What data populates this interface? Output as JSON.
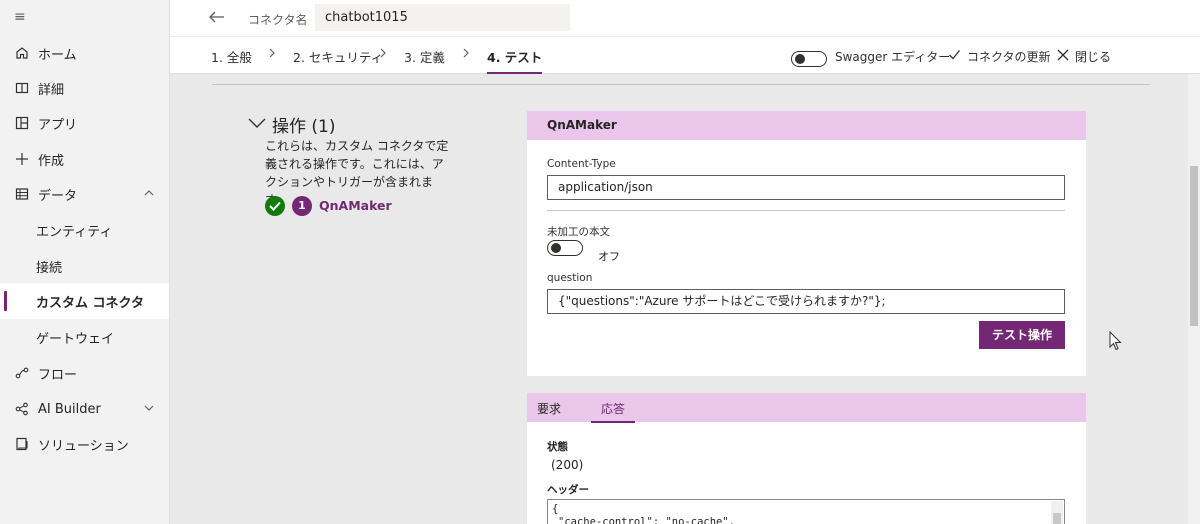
{
  "sidebar": {
    "items": [
      {
        "label": "ホーム",
        "icon": "home-icon"
      },
      {
        "label": "詳細",
        "icon": "book-icon"
      },
      {
        "label": "アプリ",
        "icon": "apps-icon"
      },
      {
        "label": "作成",
        "icon": "plus-icon"
      },
      {
        "label": "データ",
        "icon": "table-icon"
      },
      {
        "label": "エンティティ"
      },
      {
        "label": "接続"
      },
      {
        "label": "カスタム コネクタ"
      },
      {
        "label": "ゲートウェイ"
      },
      {
        "label": "フロー",
        "icon": "flow-icon"
      },
      {
        "label": "AI Builder",
        "icon": "ai-builder-icon"
      },
      {
        "label": "ソリューション",
        "icon": "solution-icon"
      }
    ],
    "active": "カスタム コネクタ"
  },
  "header": {
    "connector_label": "コネクタ名",
    "connector_name": "chatbot1015"
  },
  "steps": [
    {
      "label": "1. 全般"
    },
    {
      "label": "2. セキュリティ"
    },
    {
      "label": "3. 定義"
    },
    {
      "label": "4. テスト"
    }
  ],
  "toolbar": {
    "swagger_label": "Swagger エディター",
    "update_label": "コネクタの更新",
    "close_label": "閉じる"
  },
  "operations": {
    "title": "操作 (1)",
    "description": "これらは、カスタム コネクタで定義される操作です。これには、アクションやトリガーが含まれます。",
    "badge_number": "1",
    "operation_name": "QnAMaker"
  },
  "test_card": {
    "title": "QnAMaker",
    "content_type_label": "Content-Type",
    "content_type_value": "application/json",
    "raw_body_label": "未加工の本文",
    "raw_body_state": "オフ",
    "question_label": "question",
    "question_value": "{\"questions\":\"Azure サポートはどこで受けられますか?\"};",
    "test_button": "テスト操作"
  },
  "response_card": {
    "tabs": [
      "要求",
      "応答"
    ],
    "active_tab": "応答",
    "status_label": "状態",
    "status_value": "(200)",
    "headers_label": "ヘッダー",
    "headers_line1": "{",
    "headers_line2": "\"cache-control\": \"no-cache\","
  },
  "colors": {
    "accent": "#742774",
    "card_header": "#eac6ea",
    "success": "#107c10",
    "background": "#e9e9e9"
  }
}
